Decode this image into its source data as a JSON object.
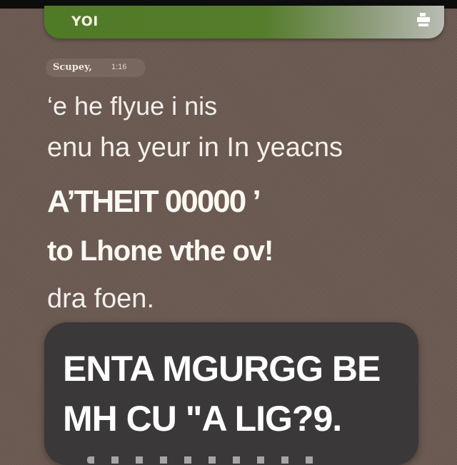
{
  "header": {
    "title": "YOI",
    "icon": "print-icon"
  },
  "message_meta": {
    "sender": "Scupey,",
    "time": "1:16"
  },
  "message": {
    "lines": [
      "‘e he flyue i nis",
      "enu ha yeur in In yeacns",
      "A’THEIT 00000 ’",
      "to Lhone vthe ov!",
      "dra foen."
    ]
  },
  "highlight_bubble": {
    "lines": [
      "ENTA MGURGG BE",
      "MH CU \"A LIG?9."
    ]
  },
  "colors": {
    "background": "#6b5a52",
    "header_green": "#557d2c",
    "bubble_dark": "#3a3838",
    "text_light": "#f3efea"
  }
}
